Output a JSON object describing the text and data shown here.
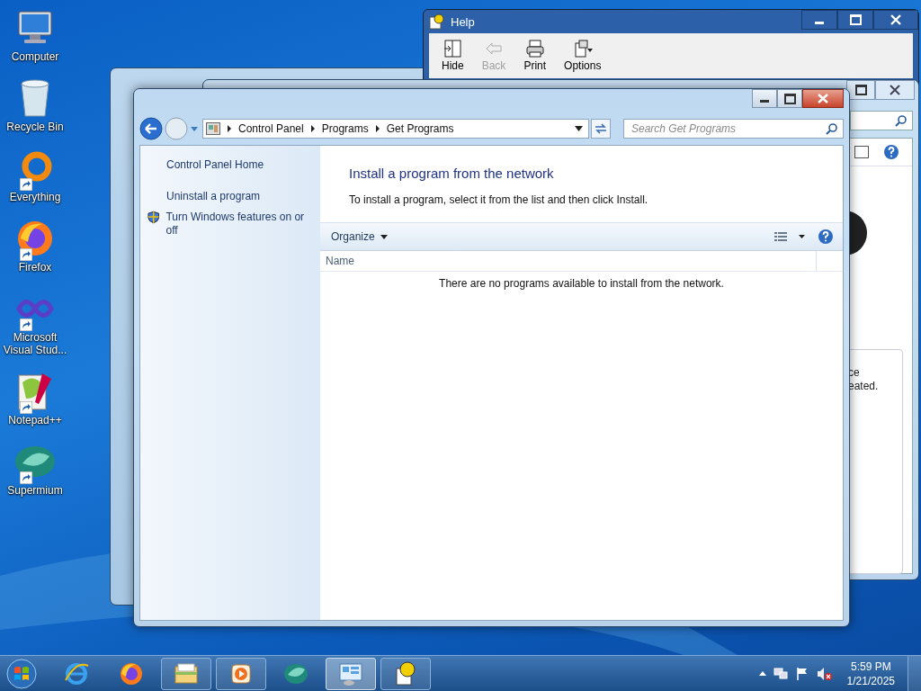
{
  "desktop_icons": [
    {
      "label": "Computer",
      "kind": "computer",
      "shortcut": false
    },
    {
      "label": "Recycle Bin",
      "kind": "recycle",
      "shortcut": false
    },
    {
      "label": "Everything",
      "kind": "everything",
      "shortcut": true
    },
    {
      "label": "Firefox",
      "kind": "firefox",
      "shortcut": true
    },
    {
      "label": "Microsoft Visual Stud...",
      "kind": "vs",
      "shortcut": true
    },
    {
      "label": "Notepad++",
      "kind": "notepad",
      "shortcut": true
    },
    {
      "label": "Supermium",
      "kind": "supermium",
      "shortcut": true
    }
  ],
  "help_window": {
    "title": "Help",
    "toolbar": [
      {
        "label": "Hide",
        "kind": "hide",
        "disabled": false
      },
      {
        "label": "Back",
        "kind": "back",
        "disabled": true
      },
      {
        "label": "Print",
        "kind": "print",
        "disabled": false
      },
      {
        "label": "Options",
        "kind": "options",
        "disabled": false
      }
    ]
  },
  "back_window": {
    "texts": [
      "ce",
      "eated."
    ]
  },
  "main_window": {
    "breadcrumbs": [
      "Control Panel",
      "Programs",
      "Get Programs"
    ],
    "search": {
      "placeholder": "Search Get Programs"
    },
    "sidebar": {
      "links": [
        {
          "label": "Control Panel Home",
          "kind": "home"
        },
        {
          "label": "Uninstall a program",
          "kind": "link"
        },
        {
          "label": "Turn Windows features on or off",
          "kind": "shield"
        }
      ]
    },
    "heading": "Install a program from the network",
    "description": "To install a program, select it from the list and then click Install.",
    "toolbar": {
      "organize": "Organize"
    },
    "columns": [
      "Name"
    ],
    "empty_message": "There are no programs available to install from the network."
  },
  "taskbar": {
    "items": [
      {
        "kind": "ie",
        "running": false,
        "selected": false
      },
      {
        "kind": "firefox",
        "running": false,
        "selected": false
      },
      {
        "kind": "explorer",
        "running": true,
        "selected": false
      },
      {
        "kind": "media",
        "running": true,
        "selected": false
      },
      {
        "kind": "supermium",
        "running": false,
        "selected": false
      },
      {
        "kind": "controlpanel",
        "running": true,
        "selected": true
      },
      {
        "kind": "help",
        "running": true,
        "selected": false
      }
    ],
    "clock": {
      "time": "5:59 PM",
      "date": "1/21/2025"
    }
  }
}
